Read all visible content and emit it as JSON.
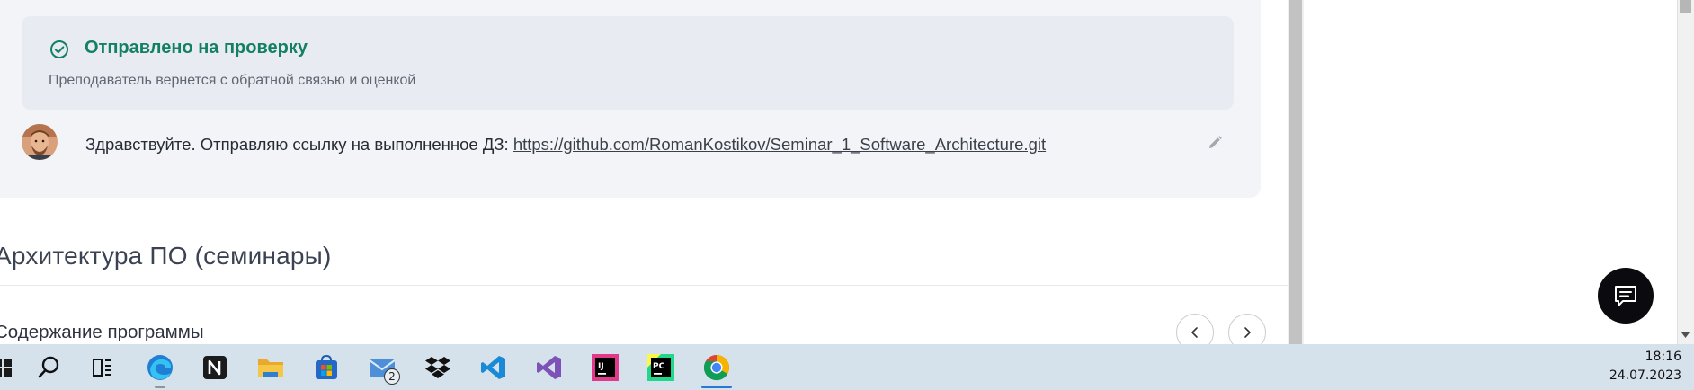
{
  "submission": {
    "status_title": "Отправлено на проверку",
    "status_subtitle": "Преподаватель вернется с обратной связью и оценкой",
    "comment_text": "Здравствуйте. Отправляю ссылку на выполненное ДЗ: ",
    "comment_link": "https://github.com/RomanKostikov/Seminar_1_Software_Architecture.git"
  },
  "course": {
    "title": "Архитектура ПО (семинары)",
    "section_title": "Содержание программы"
  },
  "colors": {
    "accent_green": "#138066",
    "taskbar_bg": "#d6e2eb",
    "active_indicator": "#2b78d4"
  },
  "taskbar": {
    "items": [
      {
        "icon": "start-icon"
      },
      {
        "icon": "search-icon"
      },
      {
        "icon": "task-view-icon"
      },
      {
        "icon": "edge-icon"
      },
      {
        "icon": "notion-icon"
      },
      {
        "icon": "file-explorer-icon"
      },
      {
        "icon": "microsoft-store-icon"
      },
      {
        "icon": "mail-icon",
        "badge": "2"
      },
      {
        "icon": "dropbox-icon"
      },
      {
        "icon": "vscode-icon"
      },
      {
        "icon": "visual-studio-icon"
      },
      {
        "icon": "intellij-idea-icon"
      },
      {
        "icon": "pycharm-icon"
      },
      {
        "icon": "chrome-icon"
      }
    ],
    "time": "18:16",
    "date": "24.07.2023"
  }
}
